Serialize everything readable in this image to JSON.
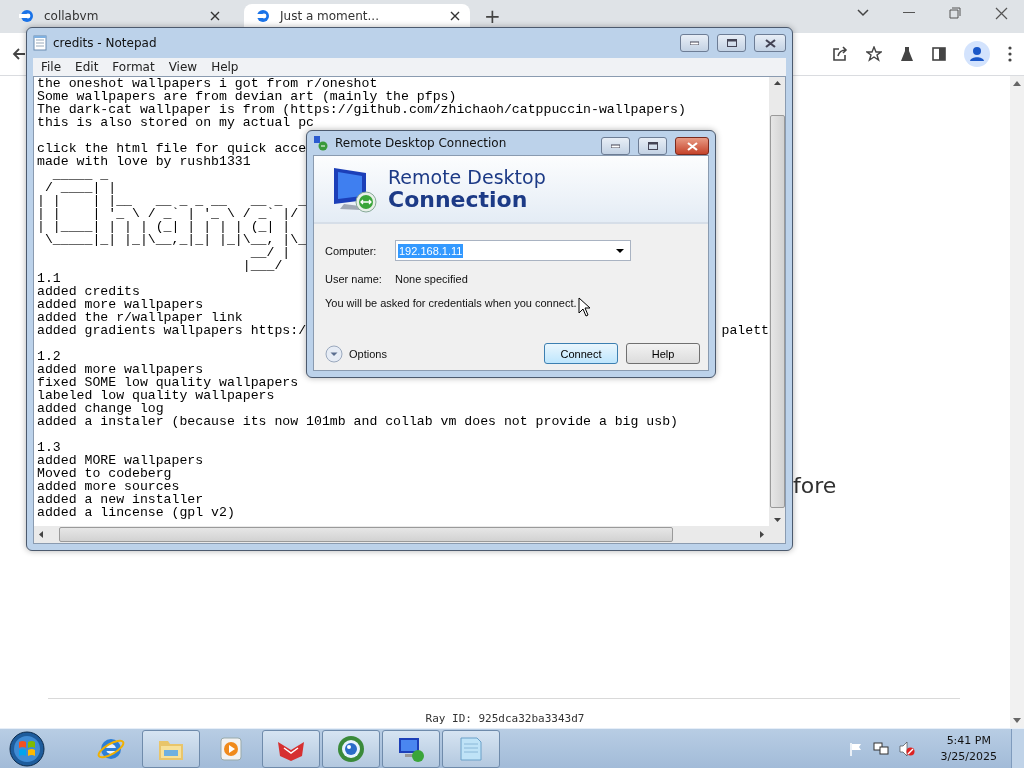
{
  "browser": {
    "tabs": [
      {
        "title": "collabvm",
        "selected": false
      },
      {
        "title": "Just a moment...",
        "selected": true
      }
    ],
    "new_tab": "+",
    "page": {
      "heading": "fore",
      "ray_id": "Ray ID: 925dca32ba3343d7"
    }
  },
  "notepad": {
    "title": "credits - Notepad",
    "menu": [
      "File",
      "Edit",
      "Format",
      "View",
      "Help"
    ],
    "lines": [
      {
        "kind": "text",
        "text": "the oneshot wallpapers i got from r/oneshot"
      },
      {
        "kind": "text",
        "text": "Some wallpapers are from devian art (mainly the pfps)"
      },
      {
        "kind": "text",
        "text": "The dark-cat wallpaper is from (https://github.com/zhichaoh/catppuccin-wallpapers)"
      },
      {
        "kind": "text",
        "text": "this is also stored on my actual pc"
      },
      {
        "kind": "blank"
      },
      {
        "kind": "text",
        "text": "click the html file for quick acce"
      },
      {
        "kind": "text",
        "text": "made with love by rushb1331"
      },
      {
        "kind": "art",
        "text": "  _____ _"
      },
      {
        "kind": "art",
        "text": " / ____| |"
      },
      {
        "kind": "art",
        "text": "| |    | |__   __ _ _ __   __ _  _"
      },
      {
        "kind": "art",
        "text": "| |    | '_ \\ / _` | '_ \\ / _` |/"
      },
      {
        "kind": "art",
        "text": "| |____| | | | (_| | | | | (_| |"
      },
      {
        "kind": "art",
        "text": " \\_____|_| |_|\\__,_|_| |_|\\__, |\\_"
      },
      {
        "kind": "art",
        "text": "                           __/ |"
      },
      {
        "kind": "art",
        "text": "                          |___/"
      },
      {
        "kind": "text",
        "text": "1.1"
      },
      {
        "kind": "text",
        "text": "added credits"
      },
      {
        "kind": "text",
        "text": "added more wallpapers"
      },
      {
        "kind": "text",
        "text": "added the r/wallpaper link"
      },
      {
        "kind": "split",
        "text": "added gradients wallpapers https:/",
        "tail": "palett"
      },
      {
        "kind": "blank"
      },
      {
        "kind": "text",
        "text": "1.2"
      },
      {
        "kind": "text",
        "text": "added more wallpapers"
      },
      {
        "kind": "text",
        "text": "fixed SOME low quality wallpapers"
      },
      {
        "kind": "text",
        "text": "labeled low quality wallpapers"
      },
      {
        "kind": "text",
        "text": "added change log"
      },
      {
        "kind": "text",
        "text": "added a instaler (because its now 101mb and collab vm does not provide a big usb)"
      },
      {
        "kind": "blank"
      },
      {
        "kind": "text",
        "text": "1.3"
      },
      {
        "kind": "text",
        "text": "added MORE wallpapers"
      },
      {
        "kind": "text",
        "text": "Moved to codeberg"
      },
      {
        "kind": "text",
        "text": "added more sources"
      },
      {
        "kind": "text",
        "text": "added a new installer"
      },
      {
        "kind": "text",
        "text": "added a lincense (gpl v2)"
      }
    ]
  },
  "rdc": {
    "title": "Remote Desktop Connection",
    "banner_light": "Remote Desktop",
    "banner_bold": "Connection",
    "computer_label": "Computer:",
    "computer_value": "192.168.1.11",
    "username_label": "User name:",
    "username_value": "None specified",
    "note": "You will be asked for credentials when you connect.",
    "options": "Options",
    "buttons": [
      {
        "label": "Connect",
        "default": true
      },
      {
        "label": "Help",
        "default": false
      }
    ]
  },
  "taskbar": {
    "items": [
      {
        "kind": "ie",
        "running": false
      },
      {
        "kind": "explorer",
        "running": true
      },
      {
        "kind": "media",
        "running": false
      },
      {
        "kind": "wing",
        "running": true
      },
      {
        "kind": "globe",
        "running": true
      },
      {
        "kind": "remote",
        "running": true
      },
      {
        "kind": "notepad",
        "running": true
      }
    ],
    "clock_time": "5:41 PM",
    "clock_date": "3/25/2025"
  }
}
